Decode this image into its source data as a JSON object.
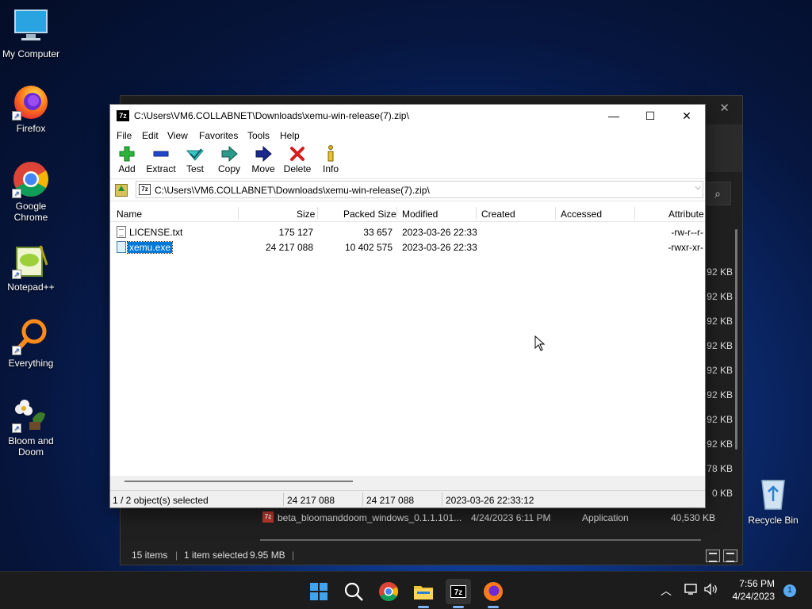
{
  "desktop": {
    "icons": [
      {
        "label": "My Computer"
      },
      {
        "label": "Firefox"
      },
      {
        "label": "Google Chrome"
      },
      {
        "label": "Notepad++"
      },
      {
        "label": "Everything"
      },
      {
        "label": "Bloom and Doom"
      },
      {
        "label": "Recycle Bin"
      }
    ]
  },
  "explorer": {
    "sizes": [
      "92 KB",
      "92 KB",
      "92 KB",
      "92 KB",
      "92 KB",
      "92 KB",
      "92 KB",
      "92 KB",
      "78 KB",
      "0 KB"
    ],
    "row": {
      "name": "beta_bloomanddoom_windows_0.1.1.101...",
      "date": "4/24/2023 6:11 PM",
      "type": "Application",
      "size": "40,530 KB"
    },
    "status": {
      "items": "15 items",
      "selected": "1 item selected",
      "size": "9.95 MB"
    }
  },
  "sevenzip": {
    "title": "C:\\Users\\VM6.COLLABNET\\Downloads\\xemu-win-release(7).zip\\",
    "logo": "7z",
    "menu": [
      "File",
      "Edit",
      "View",
      "Favorites",
      "Tools",
      "Help"
    ],
    "toolbar": [
      "Add",
      "Extract",
      "Test",
      "Copy",
      "Move",
      "Delete",
      "Info"
    ],
    "address": "C:\\Users\\VM6.COLLABNET\\Downloads\\xemu-win-release(7).zip\\",
    "columns": [
      "Name",
      "Size",
      "Packed Size",
      "Modified",
      "Created",
      "Accessed",
      "Attribute"
    ],
    "files": [
      {
        "name": "LICENSE.txt",
        "size": "175 127",
        "packed": "33 657",
        "modified": "2023-03-26 22:33",
        "attr": "-rw-r--r-"
      },
      {
        "name": "xemu.exe",
        "size": "24 217 088",
        "packed": "10 402 575",
        "modified": "2023-03-26 22:33",
        "attr": "-rwxr-xr-"
      }
    ],
    "status": {
      "selected": "1 / 2 object(s) selected",
      "size": "24 217 088",
      "packed": "24 217 088",
      "modified": "2023-03-26 22:33:12"
    }
  },
  "taskbar": {
    "time": "7:56 PM",
    "date": "4/24/2023",
    "notifications": "1"
  }
}
